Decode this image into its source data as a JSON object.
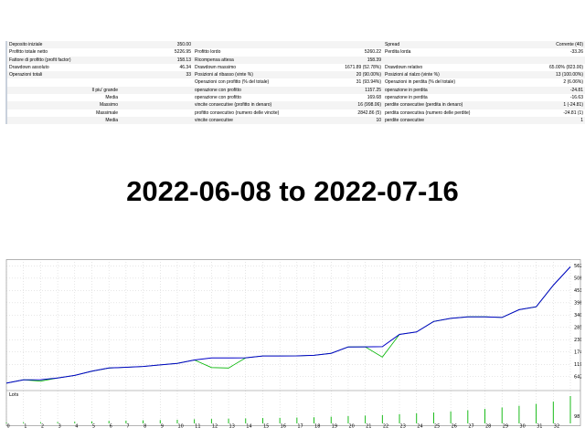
{
  "report": {
    "rows": [
      {
        "c1": "Deposito iniziale",
        "v1": "350.00",
        "c2": "",
        "v2": "",
        "c3": "Spread",
        "v3": "Corrente (40)"
      },
      {
        "c1": "Profitto totale netto",
        "v1": "5226.95",
        "c2": "Profitto lordo",
        "v2": "5260.22",
        "c3": "Perdita lorda",
        "v3": "-33.26"
      },
      {
        "c1": "Fattore di profitto (profit factor)",
        "v1": "158.13",
        "c2": "Ricompensa attesa",
        "v2": "158.39",
        "c3": "",
        "v3": ""
      },
      {
        "c1": "Drawdown assoluto",
        "v1": "46.34",
        "c2": "Drawdown massimo",
        "v2": "1671.89 (52.78%)",
        "c3": "Drawdown relativo",
        "v3": "65.00% (823.00)"
      },
      {
        "c1": "Operazioni totali",
        "v1": "33",
        "c2": "Posizioni al ribasso (vinte %)",
        "v2": "20 (90.00%)",
        "c3": "Posizioni al rialzo (vinte %)",
        "v3": "13 (100.00%)"
      },
      {
        "c1": "",
        "v1": "",
        "c2": "Operazioni con profitto (% del totale)",
        "v2": "31 (93.94%)",
        "c3": "Operazioni in perdita (% del totale)",
        "v3": "2 (6.06%)"
      },
      {
        "c1": "Il piu' grande",
        "v1": "",
        "c2": "operazione con profitto",
        "v2": "1157.25",
        "c3": "operazione in perdita",
        "v3": "-24.81"
      },
      {
        "c1": "Media",
        "v1": "",
        "c2": "operazione con profitto",
        "v2": "169.68",
        "c3": "operazione in perdita",
        "v3": "-16.63"
      },
      {
        "c1": "Massimo",
        "v1": "",
        "c2": "vincite consecutive (profitto in denaro)",
        "v2": "16 (998.06)",
        "c3": "perdite consecutive (perdita in denaro)",
        "v3": "1 (-24.81)"
      },
      {
        "c1": "Massimale",
        "v1": "",
        "c2": "profitto consecutivo (numero delle vincite)",
        "v2": "2842.86 (5)",
        "c3": "perdita consecutiva (numero delle perdite)",
        "v3": "-24.81 (1)"
      },
      {
        "c1": "Media",
        "v1": "",
        "c2": "vincite consecutive",
        "v2": "10",
        "c3": "perdite consecutive",
        "v3": "1"
      }
    ]
  },
  "headline": "2022-06-08 to 2022-07-16",
  "chart_data": {
    "type": "line",
    "series": [
      {
        "values": [
          350,
          500,
          505,
          580,
          695,
          885,
          1030,
          1060,
          1100,
          1170,
          1240,
          1390,
          1480,
          1480,
          1490,
          1570,
          1570,
          1575,
          1600,
          1690,
          1975,
          1980,
          1990,
          2540,
          2650,
          3120,
          3260,
          3330,
          3330,
          3300,
          3650,
          3780,
          4750,
          5576.95
        ]
      },
      {
        "values": [
          350,
          500,
          440,
          580,
          695,
          885,
          1030,
          1060,
          1100,
          1170,
          1240,
          1390,
          1050,
          1030,
          1490,
          1570,
          1570,
          1575,
          1600,
          1690,
          1975,
          1980,
          1520,
          2540,
          2650,
          3120,
          3260,
          3330,
          3330,
          3300,
          3650,
          3780,
          4750,
          5576.95
        ]
      }
    ],
    "y_ticks": [
      "642",
      "1195",
      "1749",
      "2301",
      "2854",
      "3406",
      "3961",
      "4516",
      "5067",
      "5622"
    ],
    "ylim": [
      180,
      5800
    ],
    "x_ticks": [
      "0",
      "1",
      "2",
      "3",
      "4",
      "5",
      "6",
      "7",
      "8",
      "9",
      "10",
      "11",
      "12",
      "13",
      "14",
      "15",
      "16",
      "17",
      "18",
      "19",
      "20",
      "21",
      "22",
      "23",
      "24",
      "25",
      "26",
      "27",
      "28",
      "29",
      "30",
      "31",
      "32"
    ],
    "xlim": [
      0,
      33
    ],
    "lots_label": "Lots",
    "lots_bottom_label": "98",
    "lots": [
      0.03,
      0.04,
      0.04,
      0.05,
      0.06,
      0.07,
      0.09,
      0.1,
      0.11,
      0.12,
      0.13,
      0.15,
      0.16,
      0.17,
      0.18,
      0.19,
      0.2,
      0.21,
      0.22,
      0.24,
      0.26,
      0.28,
      0.3,
      0.33,
      0.36,
      0.39,
      0.43,
      0.47,
      0.52,
      0.57,
      0.63,
      0.7,
      0.78,
      0.98
    ],
    "colors": {
      "balance": "#0000c8",
      "equity": "#00b400",
      "lots": "#00b400",
      "grid": "#c0c0c0"
    },
    "grid": true
  }
}
